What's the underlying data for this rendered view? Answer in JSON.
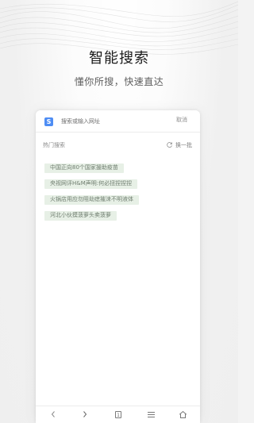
{
  "page": {
    "title": "智能搜索",
    "subtitle": "懂你所搜，快速直达"
  },
  "search": {
    "logo_label": "S",
    "placeholder": "搜索或输入网址",
    "cancel_label": "取消"
  },
  "hot": {
    "title": "热门搜索",
    "refresh_label": "换一批",
    "items": [
      "中国正向80个国家援助疫苗",
      "央视网评H&M声明:何必扭捏捏捏",
      "火锅店用应勿阻劫痣摧涞不明液体",
      "河北小伙摸菠萝头卖菠萝"
    ]
  },
  "bottom_nav": {
    "tab_count": "1",
    "icons": [
      "back-icon",
      "forward-icon",
      "tabs-icon",
      "menu-icon",
      "home-icon"
    ]
  },
  "colors": {
    "accent": "#4e8df4",
    "chip_bg": "#e7f0e6",
    "chip_text": "#6f7d6f"
  }
}
